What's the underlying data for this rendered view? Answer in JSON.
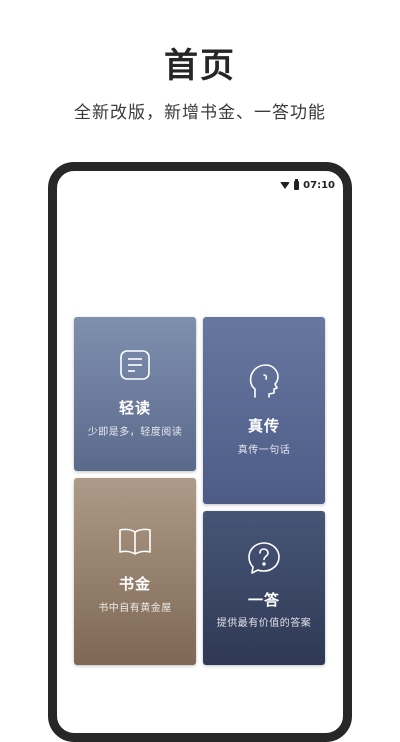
{
  "header": {
    "title": "首页",
    "subtitle": "全新改版，新增书金、一答功能"
  },
  "status_bar": {
    "time": "07:10",
    "icons": [
      "wifi-icon",
      "battery-icon"
    ]
  },
  "tiles": [
    {
      "id": "qingdu",
      "icon": "document-icon",
      "title": "轻读",
      "desc": "少即是多，轻度阅读",
      "color_top": "#7f8fae",
      "color_bottom": "#5b6a8c"
    },
    {
      "id": "zhenchuan",
      "icon": "head-profile-icon",
      "title": "真传",
      "desc": "真传一句话",
      "color_top": "#6777a0",
      "color_bottom": "#4d5c86"
    },
    {
      "id": "shujin",
      "icon": "open-book-icon",
      "title": "书金",
      "desc": "书中自有黄金屋",
      "color_top": "#ae9a88",
      "color_bottom": "#7e6755"
    },
    {
      "id": "yida",
      "icon": "question-bubble-icon",
      "title": "一答",
      "desc": "提供最有价值的答案",
      "color_top": "#475576",
      "color_bottom": "#2f3955"
    }
  ]
}
